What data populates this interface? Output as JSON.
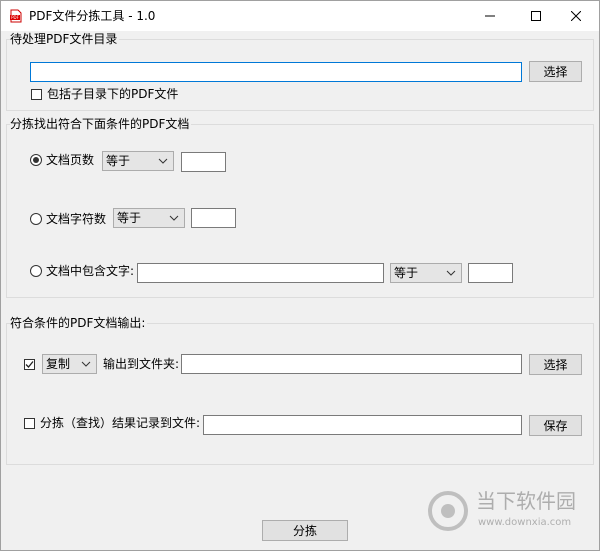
{
  "window": {
    "title": "PDF文件分拣工具 - 1.0",
    "app_icon_text": "PDF",
    "controls": {
      "minimize": "minimize-icon",
      "maximize": "maximize-icon",
      "close": "close-icon"
    }
  },
  "source": {
    "group_title": "待处理PDF文件目录",
    "path_value": "",
    "select_button": "选择",
    "include_subdirs_label": "包括子目录下的PDF文件",
    "include_subdirs_checked": false
  },
  "criteria": {
    "group_title": "分拣找出符合下面条件的PDF文档",
    "page_count": {
      "label": "文档页数",
      "selected": true,
      "operator": "等于",
      "value": ""
    },
    "char_count": {
      "label": "文档字符数",
      "selected": false,
      "operator": "等于",
      "value": ""
    },
    "contains_text": {
      "label": "文档中包含文字:",
      "selected": false,
      "text_value": "",
      "operator": "等于",
      "value": ""
    }
  },
  "output": {
    "group_title": "符合条件的PDF文档输出:",
    "copy_checked": true,
    "copy_mode": "复制",
    "output_folder_label": "输出到文件夹:",
    "output_folder_value": "",
    "select_button": "选择",
    "log_checked": false,
    "log_label": "分拣（查找）结果记录到文件:",
    "log_file_value": "",
    "save_button": "保存"
  },
  "action": {
    "sort_button": "分拣"
  },
  "watermark": {
    "brand": "当下软件园",
    "url": "www.downxia.com"
  }
}
